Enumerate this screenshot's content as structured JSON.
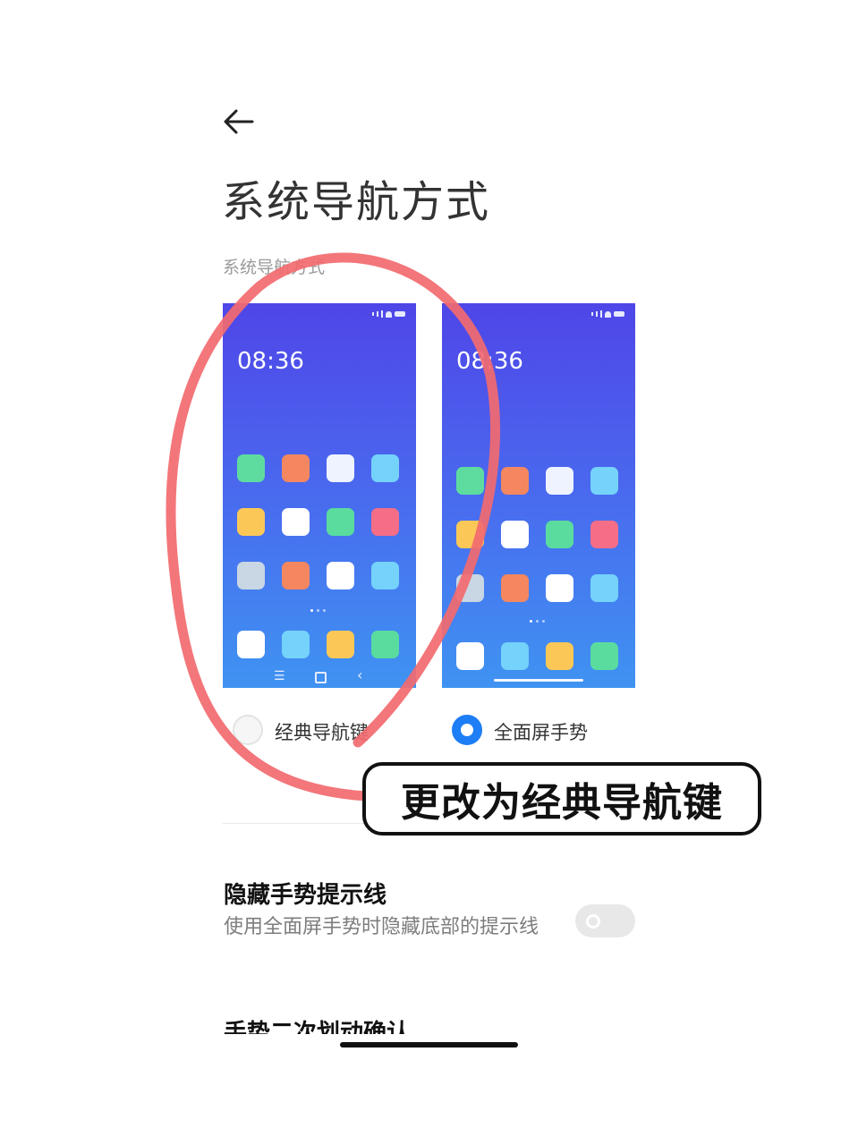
{
  "header": {
    "back_icon": "back-arrow-icon",
    "title": "系统导航方式"
  },
  "section": {
    "label": "系统导航方式"
  },
  "previews": {
    "clock": "08:36",
    "classic": {
      "apps": [
        [
          "#5edca0",
          "#f4875f",
          "#eef3ff",
          "#74d2fb"
        ],
        [
          "#fbc857",
          "#ffffff",
          "#5adc9f",
          "#f56d87"
        ],
        [
          "#c9d6e3",
          "#f4875f",
          "#ffffff",
          "#74d2fb"
        ]
      ],
      "dock": [
        "#ffffff",
        "#74d2fb",
        "#fbc857",
        "#5adc9f"
      ],
      "nav_icons": [
        "menu-lines-icon",
        "home-square-icon",
        "back-chevron-icon"
      ]
    },
    "gesture": {
      "apps": [
        [
          "#5edca0",
          "#f4875f",
          "#eef3ff",
          "#74d2fb"
        ],
        [
          "#fbc857",
          "#ffffff",
          "#5adc9f",
          "#f56d87"
        ],
        [
          "#c9d6e3",
          "#f4875f",
          "#ffffff",
          "#74d2fb"
        ]
      ],
      "dock": [
        "#ffffff",
        "#74d2fb",
        "#fbc857",
        "#5adc9f"
      ]
    }
  },
  "options": {
    "classic": {
      "label": "经典导航键",
      "selected": false
    },
    "gesture": {
      "label": "全面屏手势",
      "selected": true
    }
  },
  "settings": {
    "hide_gesture_line": {
      "title": "隐藏手势提示线",
      "description": "使用全面屏手势时隐藏底部的提示线",
      "enabled": false
    },
    "next_title": "手势二次划动确认"
  },
  "annotation": {
    "text": "更改为经典导航键"
  },
  "colors": {
    "accent": "#1e7ef5",
    "annotation_ring": "#f26a6f"
  }
}
